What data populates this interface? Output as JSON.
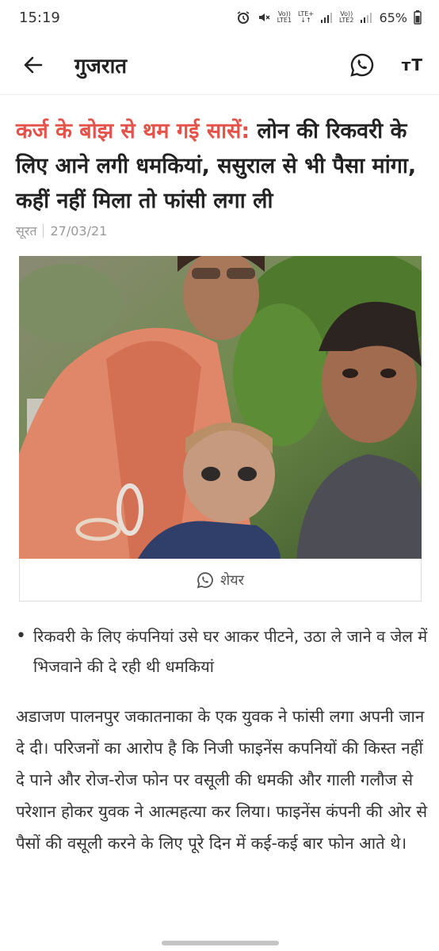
{
  "status_bar": {
    "time": "15:19",
    "sim1_top": "Vo))",
    "sim1_bottom": "LTE1",
    "sim1_net": "LTE+",
    "sim2_top": "Vo))",
    "sim2_bottom": "LTE2",
    "battery": "65%",
    "icons": [
      "alarm-icon",
      "mute-icon",
      "signal-icon",
      "battery-icon"
    ]
  },
  "app_bar": {
    "back_icon": "arrow-left-icon",
    "title": "गुजरात",
    "share_icon": "whatsapp-icon",
    "font_size_label": "ᴛT"
  },
  "article": {
    "kicker": "कर्ज के बोझ से थम गई सासें:",
    "headline": " लोन की रिकवरी के लिए आने लगी धमकियां, ससुराल से भी पैसा मांगा, कहीं नहीं मिला तो फांसी लगा ली",
    "location": "सूरत",
    "date": "27/03/21",
    "image_desc_icon": "photo",
    "share_label": "शेयर",
    "bullet": "रिकवरी के लिए कंपनियां उसे घर आकर पीटने, उठा ले जाने व जेल में भिजवाने की दे रही थी धमकियां",
    "body": "अडाजण पालनपुर जकातनाका के एक युवक ने फांसी लगा अपनी जान दे दी। परिजनों का आरोप है कि निजी फाइनेंस कपनियों की किस्त नहीं दे पाने और रोज-रोज फोन पर वसूली की धमकी और गाली गलौज से परेशान होकर युवक ने आत्महत्या कर लिया। फाइनेंस कंपनी की ओर से पैसों की वसूली करने के लिए पूरे दिन में कई-कई बार फोन आते थे।"
  },
  "colors": {
    "kicker": "#e4534a",
    "text": "#222222",
    "muted": "#999999"
  }
}
